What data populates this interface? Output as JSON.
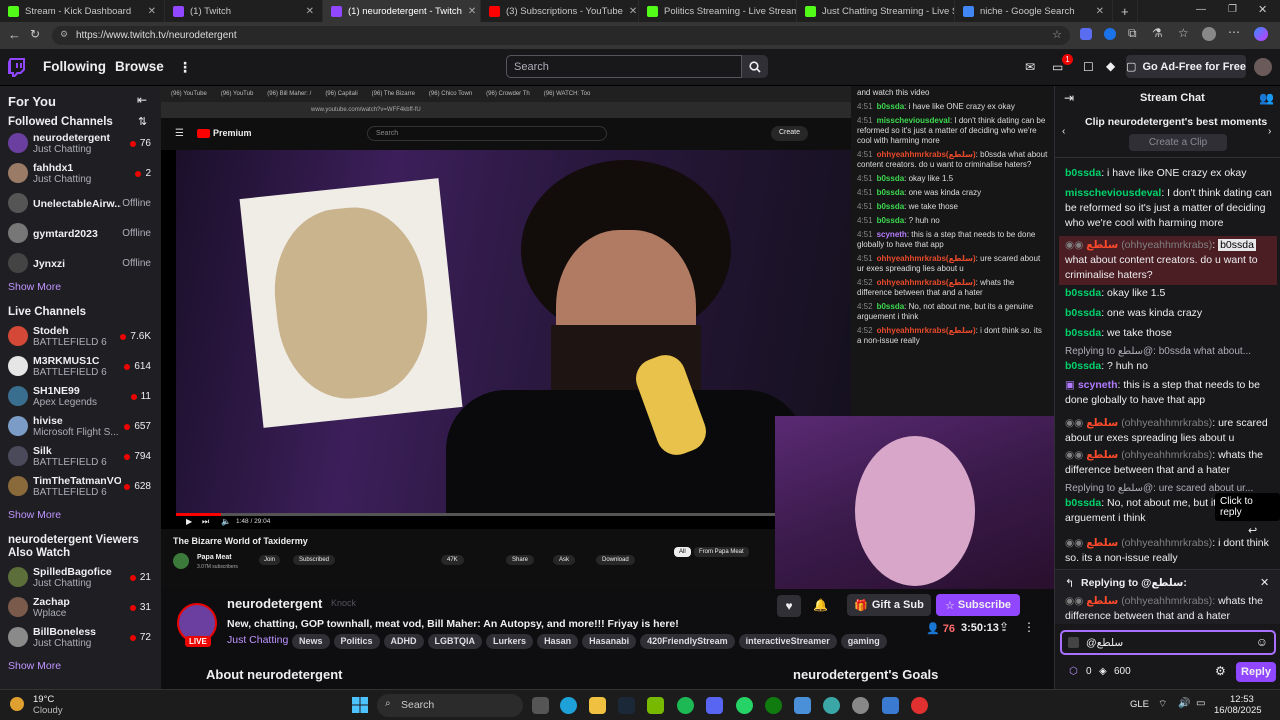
{
  "browser": {
    "tabs": [
      {
        "title": "Stream - Kick Dashboard",
        "color": "#53fc18"
      },
      {
        "title": "(1) Twitch",
        "color": "#9147ff"
      },
      {
        "title": "(1) neurodetergent - Twitch",
        "color": "#9147ff",
        "active": true
      },
      {
        "title": "(3) Subscriptions - YouTube",
        "color": "#ff0000"
      },
      {
        "title": "Politics Streaming - Live Streams",
        "color": "#53fc18"
      },
      {
        "title": "Just Chatting Streaming - Live St",
        "color": "#53fc18"
      },
      {
        "title": "niche - Google Search",
        "color": "#4285f4"
      }
    ],
    "url": "https://www.twitch.tv/neurodetergent"
  },
  "nav": {
    "following": "Following",
    "browse": "Browse",
    "search_placeholder": "Search",
    "notif_count": "1",
    "ad_free": "Go Ad-Free for Free"
  },
  "sidebar": {
    "for_you": "For You",
    "followed_heading": "Followed Channels",
    "followed": [
      {
        "name": "neurodetergent",
        "game": "Just Chatting",
        "viewers": "76",
        "live": true,
        "color": "#6b3fa0"
      },
      {
        "name": "fahhdx1",
        "game": "Just Chatting",
        "viewers": "2",
        "live": true,
        "color": "#9a7b66"
      },
      {
        "name": "UnelectableAirw...",
        "game": "",
        "viewers": "Offline",
        "live": false,
        "color": "#555"
      },
      {
        "name": "gymtard2023",
        "game": "",
        "viewers": "Offline",
        "live": false,
        "color": "#777"
      },
      {
        "name": "Jynxzi",
        "game": "",
        "viewers": "Offline",
        "live": false,
        "color": "#444"
      }
    ],
    "show_more_1": "Show More",
    "live_heading": "Live Channels",
    "live": [
      {
        "name": "Stodeh",
        "game": "BATTLEFIELD 6",
        "viewers": "7.6K",
        "color": "#d34836"
      },
      {
        "name": "M3RKMUS1C",
        "game": "BATTLEFIELD 6",
        "viewers": "614",
        "color": "#e6e6e6"
      },
      {
        "name": "SH1NE99",
        "game": "Apex Legends",
        "viewers": "11",
        "color": "#3a6e8f"
      },
      {
        "name": "hivise",
        "game": "Microsoft Flight S...",
        "viewers": "657",
        "color": "#7a9cc6"
      },
      {
        "name": "Silk",
        "game": "BATTLEFIELD 6",
        "viewers": "794",
        "color": "#4a4a5a"
      },
      {
        "name": "TimTheTatmanVO...",
        "game": "BATTLEFIELD 6",
        "viewers": "628",
        "color": "#8a6a3a"
      }
    ],
    "show_more_2": "Show More",
    "also_watch_heading": "neurodetergent Viewers Also Watch",
    "also": [
      {
        "name": "SpilledBagofice",
        "game": "Just Chatting",
        "viewers": "21",
        "color": "#5c6f3a"
      },
      {
        "name": "Zachap",
        "game": "Wplace",
        "viewers": "31",
        "color": "#7a5a4a"
      },
      {
        "name": "BillBoneless",
        "game": "Just Chatting",
        "viewers": "72",
        "color": "#8a8a8a"
      }
    ],
    "show_more_3": "Show More"
  },
  "youtube": {
    "tabs": [
      "(96) YouTube",
      "(96) YouTub",
      "(96) Bill Maher: /",
      "(96) Capitali",
      "(96) The Bizarre",
      "(96) Chico Town",
      "(96) Crowder Th",
      "(96) WATCH: Too"
    ],
    "url": "www.youtube.com/watch?v=WFF4kbff-fU",
    "premium": "Premium",
    "search": "Search",
    "create": "Create",
    "time": "1:48 / 29:04",
    "title": "The Bizarre World of Taxidermy",
    "channel": "Papa Meat",
    "subs": "3.07M subscribers",
    "join": "Join",
    "subscribed": "Subscribed",
    "likes": "47K",
    "share": "Share",
    "ask": "Ask",
    "download": "Download",
    "filter_all": "All",
    "filter_from": "From Papa Meat",
    "chat": [
      {
        "t": "",
        "u": "",
        "c": "",
        "m": "and watch this video"
      },
      {
        "t": "4:51",
        "u": "b0ssda",
        "c": "g",
        "m": "i have like ONE crazy ex okay"
      },
      {
        "t": "4:51",
        "u": "misscheviousdeval",
        "c": "g",
        "m": "I don't think dating can be reformed so it's just a matter of deciding who we're cool with harming more"
      },
      {
        "t": "4:51",
        "u": "ohhyeahhmrkrabs(سلطع)",
        "c": "r",
        "m": "b0ssda what about content creators. do u want to criminalise haters?"
      },
      {
        "t": "4:51",
        "u": "b0ssda",
        "c": "g",
        "m": "okay like 1.5"
      },
      {
        "t": "4:51",
        "u": "b0ssda",
        "c": "g",
        "m": "one was kinda crazy"
      },
      {
        "t": "4:51",
        "u": "b0ssda",
        "c": "g",
        "m": "we take those"
      },
      {
        "t": "4:51",
        "u": "b0ssda",
        "c": "g",
        "m": "? huh no"
      },
      {
        "t": "4:51",
        "u": "scyneth",
        "c": "p",
        "m": "this is a step that needs to be done globally to have that app"
      },
      {
        "t": "4:51",
        "u": "ohhyeahhmrkrabs(سلطع)",
        "c": "r",
        "m": "ure scared about ur exes spreading lies about u"
      },
      {
        "t": "4:52",
        "u": "ohhyeahhmrkrabs(سلطع)",
        "c": "r",
        "m": "whats the difference between that and a hater"
      },
      {
        "t": "4:52",
        "u": "b0ssda",
        "c": "g",
        "m": "No, not about me, but its a genuine arguement i think"
      },
      {
        "t": "4:52",
        "u": "ohhyeahhmrkrabs(سلطع)",
        "c": "r",
        "m": "i dont think so. its a non-issue really"
      }
    ]
  },
  "stream": {
    "streamer": "neurodetergent",
    "knock": "Knock",
    "title": "New, chatting, GOP townhall, meat vod, Bill Maher: An Autopsy, and more!!! Friyay is here!",
    "category": "Just Chatting",
    "tags": [
      "News",
      "Politics",
      "ADHD",
      "LGBTQIA",
      "Lurkers",
      "Hasan",
      "Hasanabi",
      "420FriendlyStream",
      "interactiveStreamer",
      "gaming"
    ],
    "viewers": "76",
    "uptime": "3:50:13",
    "gift": "Gift a Sub",
    "subscribe": "Subscribe",
    "live_badge": "LIVE",
    "about": "About neurodetergent",
    "goals": "neurodetergent's Goals"
  },
  "chat": {
    "title": "Stream Chat",
    "clip_title": "Clip neurodetergent's best moments",
    "create_clip": "Create a Clip",
    "messages": [
      {
        "user": "b0ssda",
        "cls": "grn",
        "text": "i have like ONE crazy ex okay"
      },
      {
        "user": "misscheviousdeval",
        "cls": "grn",
        "text": "I don't think dating can be reformed so it's just a matter of deciding who we're cool with harming more"
      },
      {
        "user": "سلطع",
        "alt": "(ohhyeahhmrkrabs)",
        "mention": "b0ssda",
        "cls": "red",
        "text": "what about content creators. do u want to criminalise haters?"
      },
      {
        "user": "b0ssda",
        "cls": "grn",
        "text": "okay like 1.5"
      },
      {
        "user": "b0ssda",
        "cls": "grn",
        "text": "one was kinda crazy"
      },
      {
        "user": "b0ssda",
        "cls": "grn",
        "text": "we take those"
      },
      {
        "reply": "Replying to سلطع@: b0ssda what about..."
      },
      {
        "user": "b0ssda",
        "cls": "grn",
        "text": "? huh no"
      },
      {
        "user": "scyneth",
        "cls": "pur",
        "text": "this is a step that needs to be done globally to have that app"
      },
      {
        "user": "سلطع",
        "alt": "(ohhyeahhmrkrabs)",
        "cls": "red",
        "text": "ure scared about ur exes spreading lies about u"
      },
      {
        "user": "سلطع",
        "alt": "(ohhyeahhmrkrabs)",
        "cls": "red",
        "text": "whats the difference between that and a hater"
      },
      {
        "reply": "Replying to سلطع@: ure scared about ur..."
      },
      {
        "user": "b0ssda",
        "cls": "grn",
        "text": "No, not about me, but its a genuine arguement i think"
      },
      {
        "user": "سلطع",
        "alt": "(ohhyeahhmrkrabs)",
        "cls": "red",
        "text": "i dont think so. its a non-issue really"
      }
    ],
    "tooltip": "Click to reply",
    "replying_to": "Replying to @سلطع:",
    "reply_user": "سلطع",
    "reply_alt": "(ohhyeahhmrkrabs):",
    "reply_text": "whats the difference between that and a hater",
    "input_value": "@سلطع",
    "points": "0",
    "bits": "600",
    "send": "Reply"
  },
  "taskbar": {
    "temp": "19°C",
    "weather": "Cloudy",
    "search": "Search",
    "lang": "GLE",
    "time": "12:53",
    "date": "16/08/2025"
  }
}
